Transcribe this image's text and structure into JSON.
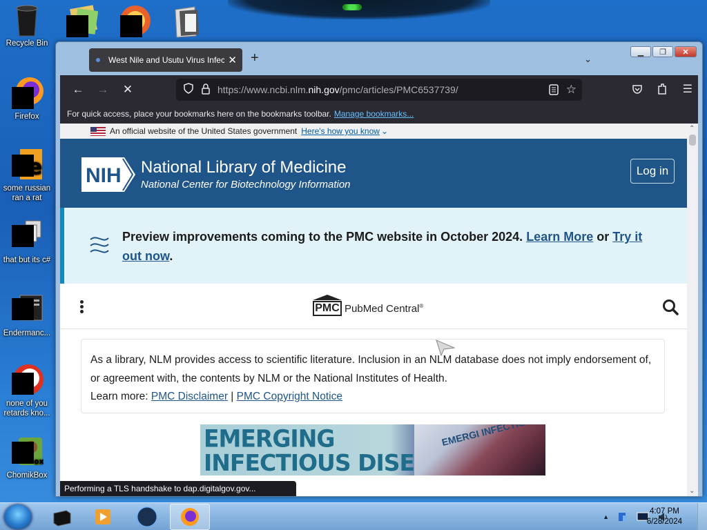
{
  "desktop": {
    "icons": [
      {
        "label": "Recycle Bin"
      },
      {
        "label": "Firefox"
      },
      {
        "label": "some russian ran a rat"
      },
      {
        "label": "that but its c#"
      },
      {
        "label": "Endermanc..."
      },
      {
        "label": "none of you retards kno..."
      },
      {
        "label": "ChomikBox"
      }
    ]
  },
  "browser": {
    "tab_title": "West Nile and Usutu Virus Infect",
    "url_prefix": "https://www.ncbi.nlm.",
    "url_host": "nih.gov",
    "url_path": "/pmc/articles/PMC6537739/",
    "bookmarks_hint": "For quick access, place your bookmarks here on the bookmarks toolbar.",
    "bookmarks_link": "Manage bookmarks...",
    "status_tip": "Performing a TLS handshake to dap.digitalgov.gov..."
  },
  "page": {
    "gov_banner_text": "An official website of the United States government",
    "gov_banner_link": "Here's how you know",
    "nih_logo_text": "NIH",
    "header_title": "National Library of Medicine",
    "header_subtitle": "National Center for Biotechnology Information",
    "login_label": "Log in",
    "preview_text": "Preview improvements coming to the PMC website in October 2024.",
    "preview_learn_more": "Learn More",
    "preview_or": "or",
    "preview_try": "Try it out now",
    "preview_end": ".",
    "pmc_mark": "PMC",
    "pmc_name": "PubMed Central",
    "pmc_reg": "®",
    "disclaimer_text": "As a library, NLM provides access to scientific literature. Inclusion in an NLM database does not imply endorsement of, or agreement with, the contents by NLM or the National Institutes of Health.",
    "learn_more_label": "Learn more:",
    "disclaimer_link": "PMC Disclaimer",
    "separator": "|",
    "copyright_link": "PMC Copyright Notice",
    "banner_line1": "EMERGING",
    "banner_line2": "INFECTIOUS DISEASES",
    "banner_reg": "®",
    "banner_cover_text": "EMERGI INFECTIOU"
  },
  "taskbar": {
    "time": "4:07 PM",
    "date": "6/28/2024"
  },
  "colors": {
    "nlm_blue": "#20558a",
    "preview_bg": "#e1f3f8",
    "firefox_chrome": "#2b2a33"
  }
}
